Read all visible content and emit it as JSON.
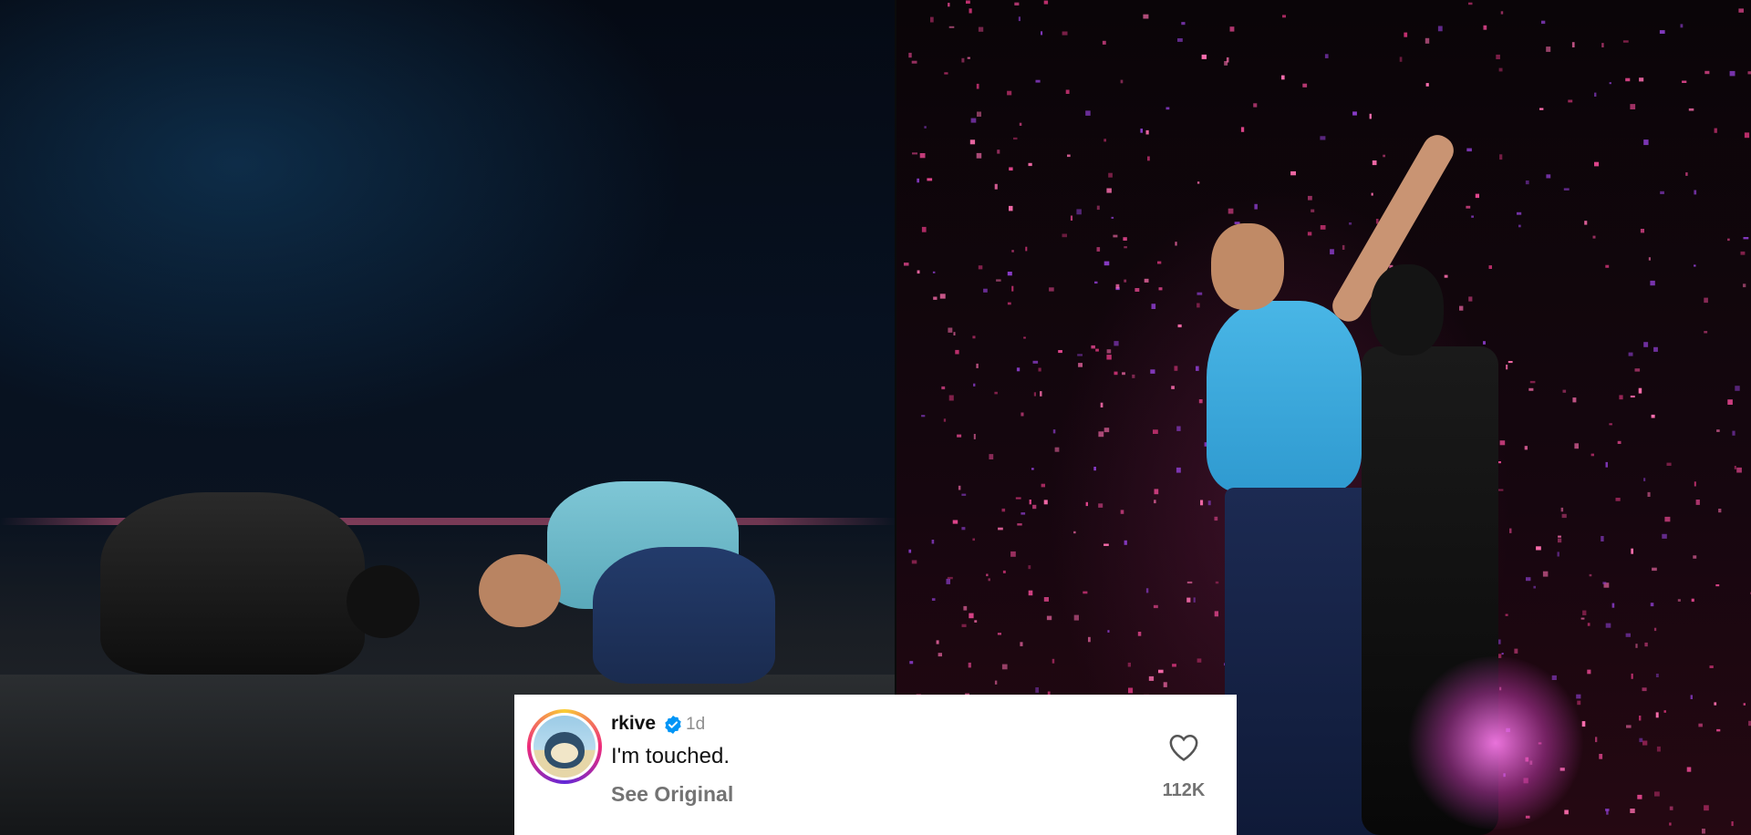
{
  "images": {
    "left_photo": "concert photo – two performers bowing on stage",
    "right_photo": "concert photo – performers singing amid pink confetti"
  },
  "comment": {
    "username": "rkive",
    "verified_icon": "verified-badge-icon",
    "timestamp": "1d",
    "text": "I'm touched.",
    "see_original_label": "See Original",
    "like_icon": "heart-icon",
    "like_count": "112K"
  },
  "colors": {
    "verified": "#0095f6",
    "avatar_ring": [
      "#f9ce34",
      "#ee2a7b",
      "#6228d7"
    ],
    "confetti": "#e0458c"
  }
}
